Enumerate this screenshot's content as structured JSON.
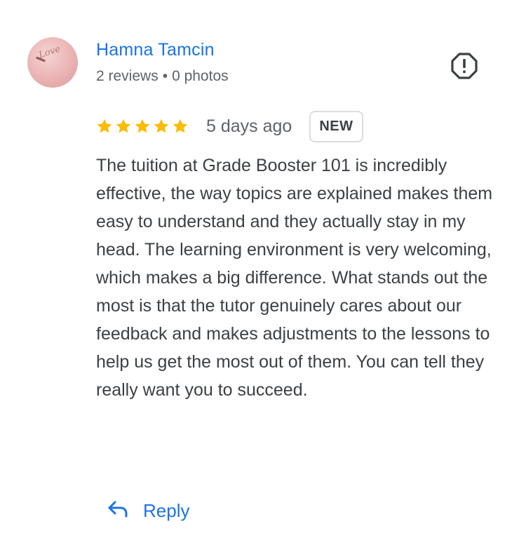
{
  "author": {
    "name": "Hamna Tamcin",
    "reviews": "2 reviews",
    "separator": "•",
    "photos": "0 photos",
    "avatar_text": "Love"
  },
  "review": {
    "rating": 5,
    "max_rating": 5,
    "date": "5 days ago",
    "badge": "NEW",
    "text": "The tuition at Grade Booster 101 is incredibly effective, the way topics are explained makes them easy to understand and they actually stay in my head. The learning environment is very welcoming, which makes a big difference. What stands out the most is that the tutor genuinely cares about our feedback and makes adjustments to the lessons to help us get the most out of them. You can tell they really want you to succeed."
  },
  "actions": {
    "reply_label": "Reply",
    "report_icon": "report-icon",
    "reply_icon": "reply-arrow-icon"
  },
  "colors": {
    "link": "#1a73e8",
    "star": "#fbbc04",
    "text": "#3c4043",
    "secondary": "#5f6368",
    "badge_border": "#dadce0"
  }
}
